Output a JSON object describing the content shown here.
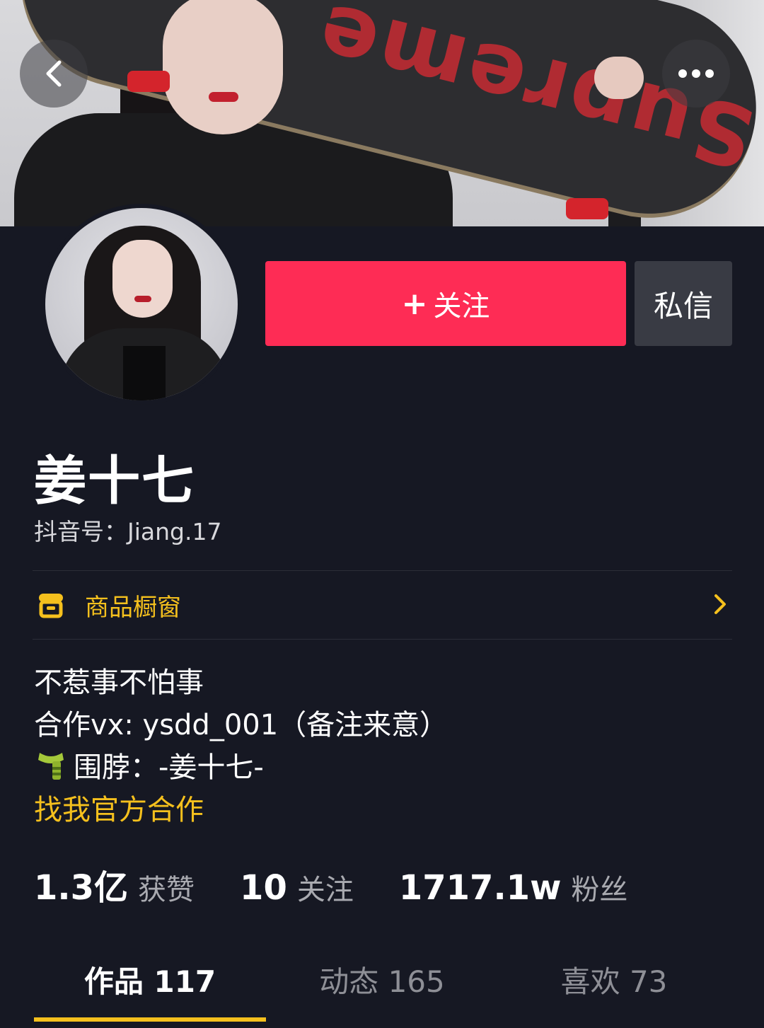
{
  "header": {
    "back_icon": "chevron-left-icon",
    "more_icon": "more-horizontal-icon"
  },
  "cover": {
    "board_text": "Supreme"
  },
  "actions": {
    "follow_label": "关注",
    "follow_plus": "+",
    "message_label": "私信",
    "follow_color": "#fe2c55"
  },
  "profile": {
    "name": "姜十七",
    "douyin_id": "抖音号：Jiang.17"
  },
  "shop": {
    "label": "商品橱窗",
    "accent": "#f5c01d"
  },
  "bio": {
    "line1": "不惹事不怕事",
    "line2": "合作vx: ysdd_001（备注来意）",
    "line3": "围脖：-姜十七-",
    "line4": "找我官方合作"
  },
  "stats": [
    {
      "value": "1.3亿",
      "label": "获赞"
    },
    {
      "value": "10",
      "label": "关注"
    },
    {
      "value": "1717.1w",
      "label": "粉丝"
    }
  ],
  "tabs": [
    {
      "label": "作品 117",
      "active": true
    },
    {
      "label": "动态 165",
      "active": false
    },
    {
      "label": "喜欢 73",
      "active": false
    }
  ]
}
